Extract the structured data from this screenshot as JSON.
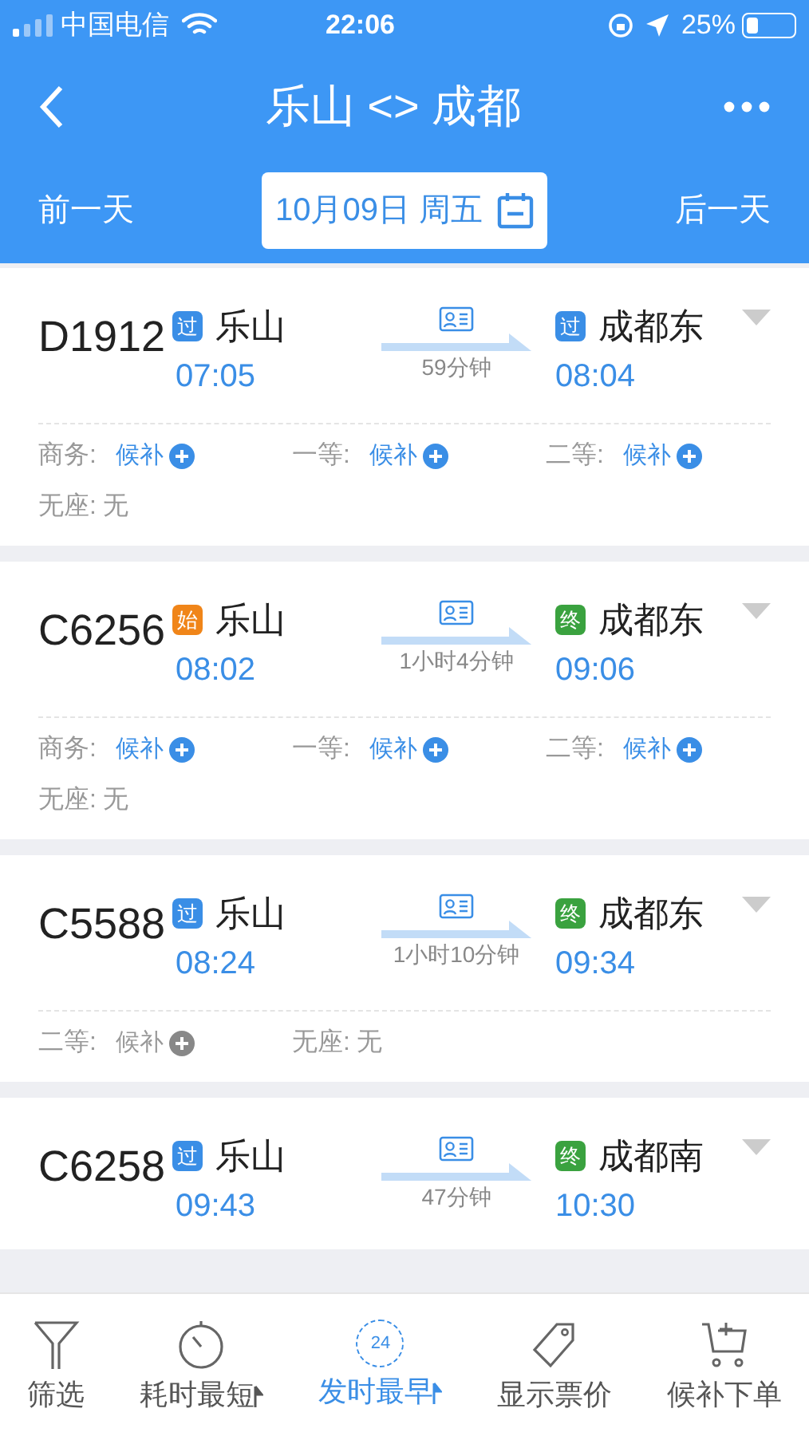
{
  "status_bar": {
    "carrier": "中国电信",
    "time": "22:06",
    "battery": "25%"
  },
  "header": {
    "title": "乐山 <> 成都"
  },
  "date_bar": {
    "prev": "前一天",
    "date": "10月09日 周五",
    "next": "后一天"
  },
  "trains": [
    {
      "number": "D1912",
      "from_badge": {
        "label": "过",
        "color": "#3a8ee6"
      },
      "from": "乐山",
      "depart": "07:05",
      "duration": "59分钟",
      "to_badge": {
        "label": "过",
        "color": "#3a8ee6"
      },
      "to": "成都东",
      "arrive": "08:04",
      "seats": [
        {
          "kind": "waitlist",
          "label": "商务:",
          "status": "候补",
          "disabled": false
        },
        {
          "kind": "waitlist",
          "label": "一等:",
          "status": "候补",
          "disabled": false
        },
        {
          "kind": "waitlist",
          "label": "二等:",
          "status": "候补",
          "disabled": false
        },
        {
          "kind": "plain",
          "label": "无座:",
          "status": "无"
        }
      ]
    },
    {
      "number": "C6256",
      "from_badge": {
        "label": "始",
        "color": "#f08519"
      },
      "from": "乐山",
      "depart": "08:02",
      "duration": "1小时4分钟",
      "to_badge": {
        "label": "终",
        "color": "#3aa23f"
      },
      "to": "成都东",
      "arrive": "09:06",
      "seats": [
        {
          "kind": "waitlist",
          "label": "商务:",
          "status": "候补",
          "disabled": false
        },
        {
          "kind": "waitlist",
          "label": "一等:",
          "status": "候补",
          "disabled": false
        },
        {
          "kind": "waitlist",
          "label": "二等:",
          "status": "候补",
          "disabled": false
        },
        {
          "kind": "plain",
          "label": "无座:",
          "status": "无"
        }
      ]
    },
    {
      "number": "C5588",
      "from_badge": {
        "label": "过",
        "color": "#3a8ee6"
      },
      "from": "乐山",
      "depart": "08:24",
      "duration": "1小时10分钟",
      "to_badge": {
        "label": "终",
        "color": "#3aa23f"
      },
      "to": "成都东",
      "arrive": "09:34",
      "seats": [
        {
          "kind": "waitlist",
          "label": "二等:",
          "status": "候补",
          "disabled": true
        },
        {
          "kind": "plain",
          "label": "无座:",
          "status": "无"
        }
      ]
    },
    {
      "number": "C6258",
      "from_badge": {
        "label": "过",
        "color": "#3a8ee6"
      },
      "from": "乐山",
      "depart": "09:43",
      "duration": "47分钟",
      "to_badge": {
        "label": "终",
        "color": "#3aa23f"
      },
      "to": "成都南",
      "arrive": "10:30"
    }
  ],
  "bottom_tabs": [
    {
      "kind": "filter",
      "label": "筛选",
      "selected": false
    },
    {
      "kind": "duration",
      "label": "耗时最短",
      "selected": false,
      "sortable": true
    },
    {
      "kind": "depart",
      "label": "发时最早",
      "selected": true,
      "sortable": true,
      "icon_text": "24"
    },
    {
      "kind": "price",
      "label": "显示票价",
      "selected": false
    },
    {
      "kind": "waitlist",
      "label": "候补下单",
      "selected": false
    }
  ]
}
